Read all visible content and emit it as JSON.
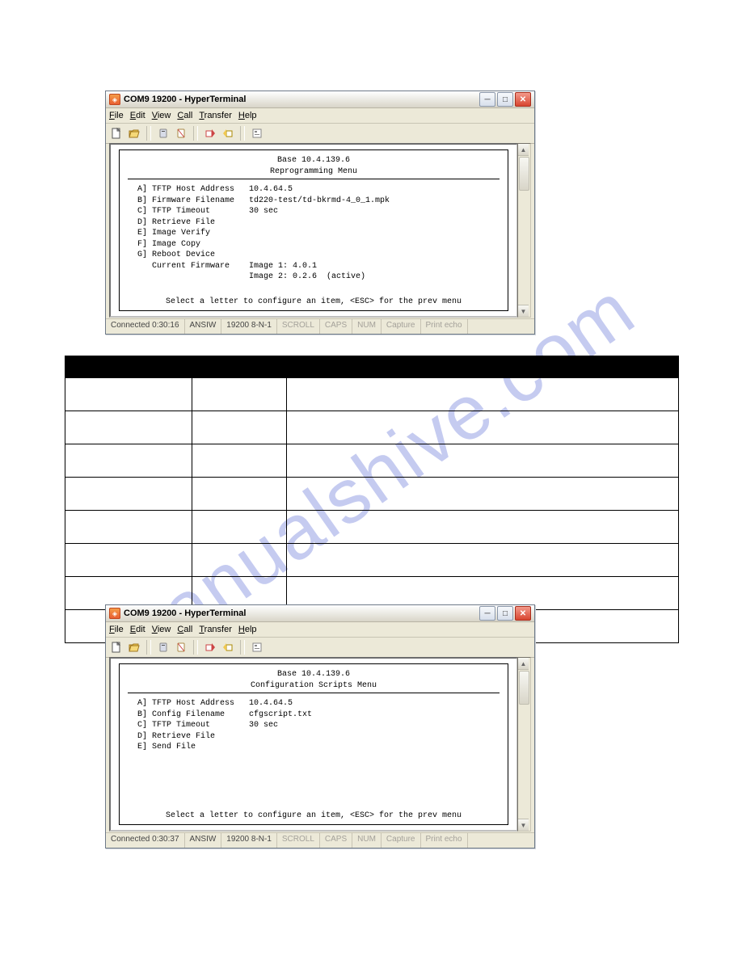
{
  "watermark": "manualshive.com",
  "menu": {
    "file_u": "F",
    "file_r": "ile",
    "edit_u": "E",
    "edit_r": "dit",
    "view_u": "V",
    "view_r": "iew",
    "call_u": "C",
    "call_r": "all",
    "transfer_u": "T",
    "transfer_r": "ransfer",
    "help_u": "H",
    "help_r": "elp"
  },
  "footer_text": "Select a letter to configure an item, <ESC> for the prev menu",
  "status": {
    "emulation": "ANSIW",
    "port": "19200 8-N-1",
    "scroll": "SCROLL",
    "caps": "CAPS",
    "num": "NUM",
    "capture": "Capture",
    "printecho": "Print echo"
  },
  "win1": {
    "title": "COM9 19200 - HyperTerminal",
    "header_ip": "Base 10.4.139.6",
    "header_title": "Reprogramming Menu",
    "rows": [
      "  A] TFTP Host Address   10.4.64.5",
      "  B] Firmware Filename   td220-test/td-bkrmd-4_0_1.mpk",
      "  C] TFTP Timeout        30 sec",
      "  D] Retrieve File",
      "  E] Image Verify",
      "  F] Image Copy",
      "  G] Reboot Device",
      "     Current Firmware    Image 1: 4.0.1",
      "                         Image 2: 0.2.6  (active)"
    ],
    "status": {
      "connected": "Connected 0:30:16"
    }
  },
  "win2": {
    "title": "COM9 19200 - HyperTerminal",
    "header_ip": "Base 10.4.139.6",
    "header_title": "Configuration Scripts Menu",
    "rows": [
      "  A] TFTP Host Address   10.4.64.5",
      "  B] Config Filename     cfgscript.txt",
      "  C] TFTP Timeout        30 sec",
      "  D] Retrieve File",
      "  E] Send File"
    ],
    "status": {
      "connected": "Connected 0:30:37"
    }
  },
  "table": {
    "head": [
      "",
      "",
      ""
    ]
  }
}
